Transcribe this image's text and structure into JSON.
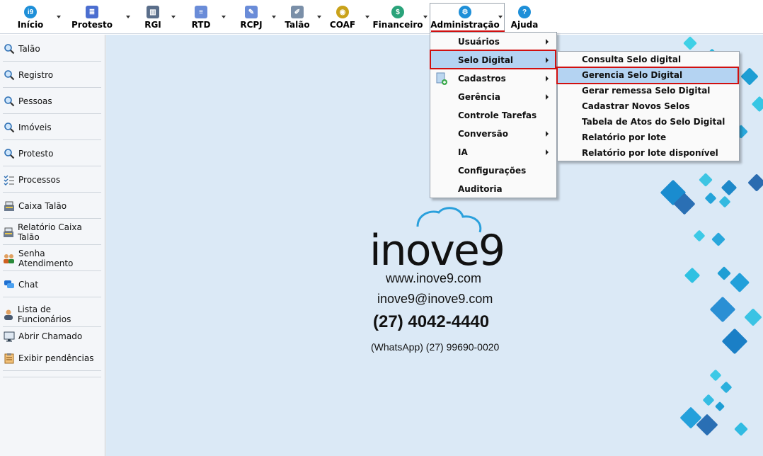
{
  "toolbar": {
    "items": [
      {
        "label": "Início",
        "icon": "inove9-logo-icon"
      },
      {
        "label": "Protesto",
        "icon": "document-stack-icon"
      },
      {
        "label": "RGI",
        "icon": "books-icon"
      },
      {
        "label": "RTD",
        "icon": "document-lines-icon"
      },
      {
        "label": "RCPJ",
        "icon": "document-pen-icon"
      },
      {
        "label": "Talão",
        "icon": "notepad-icon"
      },
      {
        "label": "COAF",
        "icon": "coaf-seal-icon"
      },
      {
        "label": "Financeiro",
        "icon": "money-cycle-icon"
      },
      {
        "label": "Administração",
        "icon": "wrench-gear-icon"
      },
      {
        "label": "Ajuda",
        "icon": "help-icon"
      }
    ]
  },
  "sidebar": {
    "items": [
      {
        "label": "Talão",
        "icon": "magnifier-icon"
      },
      {
        "label": "Registro",
        "icon": "magnifier-icon"
      },
      {
        "label": "Pessoas",
        "icon": "magnifier-icon"
      },
      {
        "label": "Imóveis",
        "icon": "magnifier-icon"
      },
      {
        "label": "Protesto",
        "icon": "magnifier-icon"
      },
      {
        "label": "Processos",
        "icon": "checklist-icon"
      },
      {
        "label": "Caixa Talão",
        "icon": "cash-register-icon"
      },
      {
        "label": "Relatório Caixa Talão",
        "icon": "cash-register-icon"
      },
      {
        "label": "Senha Atendimento",
        "icon": "people-icon"
      },
      {
        "label": "Chat",
        "icon": "chat-bubbles-icon"
      },
      {
        "label": "Lista de Funcionários",
        "icon": "person-icon"
      },
      {
        "label": "Abrir Chamado",
        "icon": "monitor-icon"
      },
      {
        "label": "Exibir pendências",
        "icon": "clipboard-icon"
      }
    ]
  },
  "admin_menu": {
    "items": [
      {
        "label": "Usuários",
        "submenu": true
      },
      {
        "label": "Selo Digital",
        "submenu": true,
        "highlighted": true
      },
      {
        "label": "Cadastros",
        "submenu": true
      },
      {
        "label": "Gerência",
        "submenu": true
      },
      {
        "label": "Controle Tarefas",
        "submenu": false
      },
      {
        "label": "Conversão",
        "submenu": true
      },
      {
        "label": "IA",
        "submenu": true
      },
      {
        "label": "Configurações",
        "submenu": false
      },
      {
        "label": "Auditoria",
        "submenu": false
      }
    ]
  },
  "selo_submenu": {
    "items": [
      {
        "label": "Consulta Selo digital"
      },
      {
        "label": "Gerencia Selo Digital",
        "highlighted": true
      },
      {
        "label": "Gerar remessa Selo Digital"
      },
      {
        "label": "Cadastrar Novos Selos"
      },
      {
        "label": "Tabela de Atos do Selo Digital"
      },
      {
        "label": "Relatório por lote"
      },
      {
        "label": "Relatório por lote disponível"
      }
    ]
  },
  "brand": {
    "logo_text": "inove9",
    "website": "www.inove9.com",
    "email": "inove9@inove9.com",
    "phone": "(27) 4042-4440",
    "whatsapp": "(WhatsApp) (27) 99690-0020"
  },
  "colors": {
    "accent_blue": "#1e8fd8",
    "highlight": "#b4d3f2",
    "selection_border": "#d01010",
    "background": "#dbe9f6"
  }
}
